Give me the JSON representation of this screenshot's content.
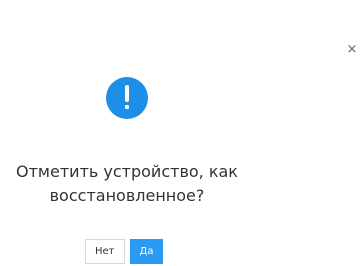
{
  "dialog": {
    "close_glyph": "×",
    "icon": "exclamation-icon",
    "title_line1": "Отметить устройство, как",
    "title_line2": "восстановленное?",
    "buttons": {
      "no_label": "Нет",
      "yes_label": "Да"
    }
  },
  "colors": {
    "accent": "#1e8fe6",
    "primary_button": "#2b9af3"
  }
}
